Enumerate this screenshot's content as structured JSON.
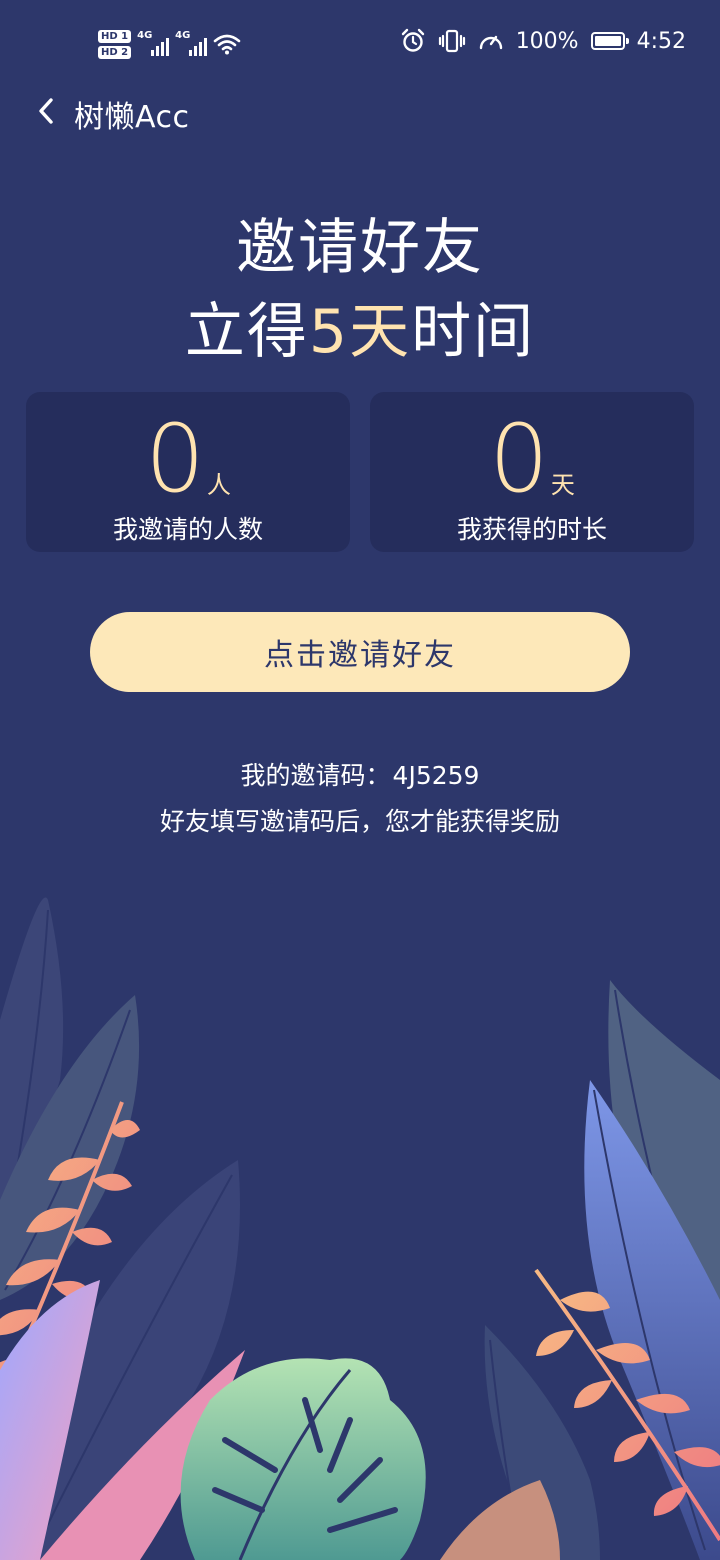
{
  "status_bar": {
    "sim1": "HD 1",
    "sim2": "HD 2",
    "network1": "4G",
    "network2": "4G",
    "battery": "100%",
    "time": "4:52",
    "icons": [
      "wifi-icon",
      "alarm-icon",
      "vibrate-icon",
      "speed-icon",
      "battery-icon"
    ]
  },
  "header": {
    "back_icon": "chevron-left-icon",
    "title": "树懒Acc"
  },
  "headline": {
    "line1": "邀请好友",
    "line2_prefix": "立得",
    "line2_highlight": "5天",
    "line2_suffix": "时间"
  },
  "stats": {
    "invited": {
      "value": "0",
      "unit": "人",
      "label": "我邀请的人数"
    },
    "earned": {
      "value": "0",
      "unit": "天",
      "label": "我获得的时长"
    }
  },
  "invite_button": {
    "label": "点击邀请好友"
  },
  "invite_code": {
    "label": "我的邀请码：",
    "code": "4J5259",
    "note": "好友填写邀请码后，您才能获得奖励"
  },
  "colors": {
    "background": "#2d376b",
    "card": "#252d5c",
    "accent": "#ffe3b0",
    "button": "#fde8b9"
  }
}
